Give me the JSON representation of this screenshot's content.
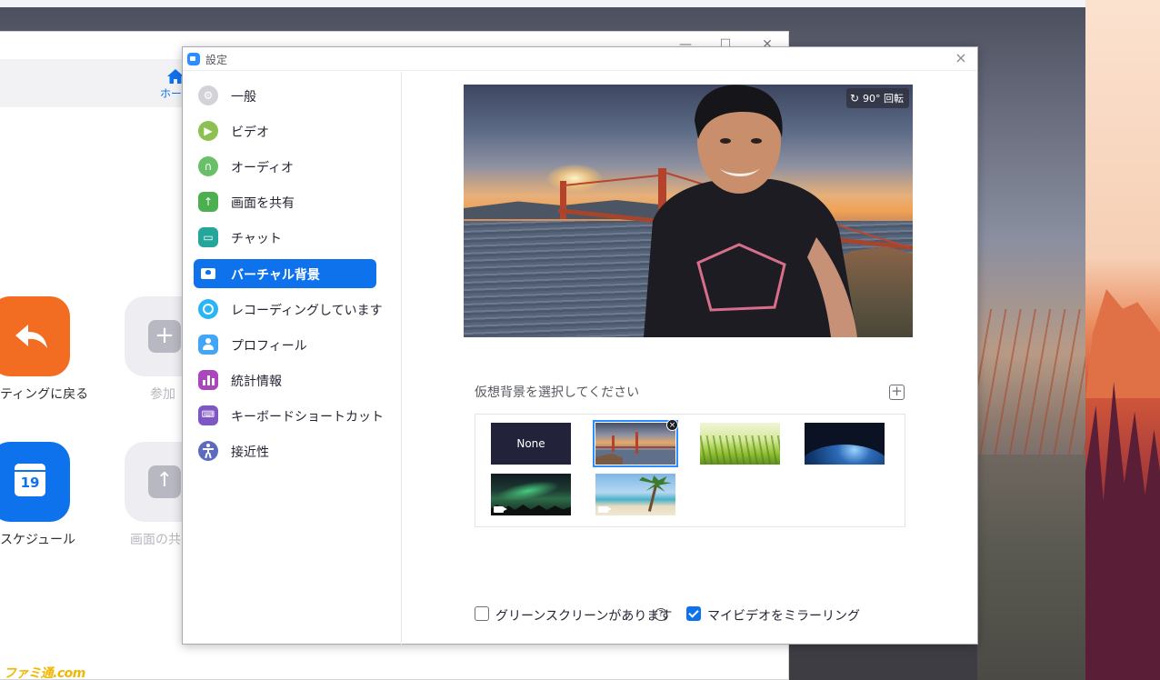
{
  "settings_dialog": {
    "title": "設定",
    "close_symbol": "×",
    "nav_items": [
      {
        "label": "一般",
        "icon": "gear-icon",
        "color": "#c9c9cf",
        "active": false
      },
      {
        "label": "ビデオ",
        "icon": "video-icon",
        "color": "#8cc152",
        "active": false
      },
      {
        "label": "オーディオ",
        "icon": "headphones-icon",
        "color": "#6abf69",
        "active": false
      },
      {
        "label": "画面を共有",
        "icon": "share-screen-icon",
        "color": "#4caf50",
        "active": false
      },
      {
        "label": "チャット",
        "icon": "chat-icon",
        "color": "#26a69a",
        "active": false
      },
      {
        "label": "バーチャル背景",
        "icon": "virtual-background-icon",
        "color": "#ffffff",
        "active": true
      },
      {
        "label": "レコーディングしています",
        "icon": "record-icon",
        "color": "#29b6f6",
        "active": false
      },
      {
        "label": "プロフィール",
        "icon": "profile-icon",
        "color": "#42a5f5",
        "active": false
      },
      {
        "label": "統計情報",
        "icon": "statistics-icon",
        "color": "#ab47bc",
        "active": false
      },
      {
        "label": "キーボードショートカット",
        "icon": "keyboard-icon",
        "color": "#7e57c2",
        "active": false
      },
      {
        "label": "接近性",
        "icon": "accessibility-icon",
        "color": "#5c6bc0",
        "active": false
      }
    ],
    "preview": {
      "rotate_label": "90° 回転",
      "rotate_icon": "rotate-icon"
    },
    "choose_background_label": "仮想背景を選択してください",
    "add_background_symbol": "+",
    "backgrounds": [
      {
        "name": "none",
        "label": "None",
        "selected": false,
        "video": false
      },
      {
        "name": "golden-gate-bridge",
        "label": "",
        "selected": true,
        "video": false
      },
      {
        "name": "grass",
        "label": "",
        "selected": false,
        "video": false
      },
      {
        "name": "earth-space",
        "label": "",
        "selected": false,
        "video": false
      },
      {
        "name": "aurora",
        "label": "",
        "selected": false,
        "video": true
      },
      {
        "name": "beach",
        "label": "",
        "selected": false,
        "video": true
      }
    ],
    "delete_symbol": "×",
    "green_screen": {
      "label": "グリーンスクリーンがあります",
      "checked": false,
      "help_symbol": "?"
    },
    "mirror_video": {
      "label": "マイビデオをミラーリング",
      "checked": true
    }
  },
  "main_window": {
    "home_tab_label": "ホー",
    "minimize_symbol": "—",
    "maximize_symbol": "☐",
    "close_symbol": "✕",
    "tiles": [
      {
        "label": "ティングに戻る",
        "icon": "return-arrow-icon",
        "color": "#f26d21"
      },
      {
        "label": "参加",
        "icon": "plus-icon",
        "color": "#ededf2"
      },
      {
        "label": "スケジュール",
        "icon": "calendar-icon",
        "color": "#0e72ed",
        "calendar_day": "19"
      },
      {
        "label": "画面の共",
        "icon": "share-up-arrow-icon",
        "color": "#ededf2"
      }
    ]
  },
  "watermark": "ファミ通.com"
}
